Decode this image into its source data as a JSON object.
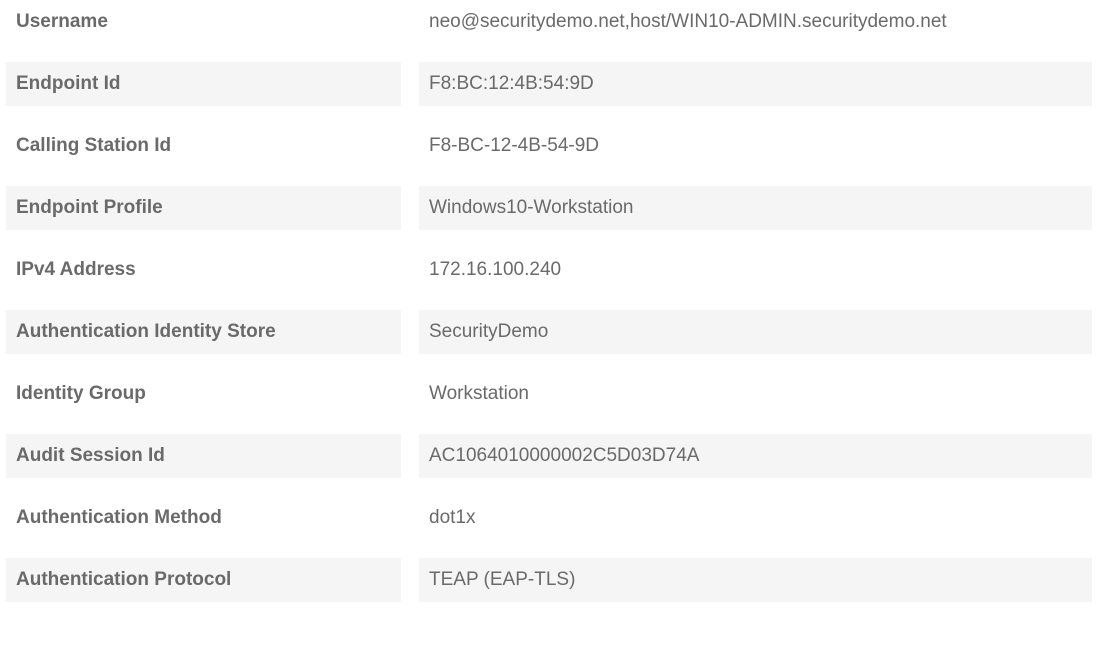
{
  "rows": [
    {
      "label": "Username",
      "value": "neo@securitydemo.net,host/WIN10-ADMIN.securitydemo.net"
    },
    {
      "label": "Endpoint Id",
      "value": "F8:BC:12:4B:54:9D"
    },
    {
      "label": "Calling Station Id",
      "value": "F8-BC-12-4B-54-9D"
    },
    {
      "label": "Endpoint Profile",
      "value": "Windows10-Workstation"
    },
    {
      "label": "IPv4 Address",
      "value": "172.16.100.240"
    },
    {
      "label": "Authentication Identity Store",
      "value": "SecurityDemo"
    },
    {
      "label": "Identity Group",
      "value": "Workstation"
    },
    {
      "label": "Audit Session Id",
      "value": "AC1064010000002C5D03D74A"
    },
    {
      "label": "Authentication Method",
      "value": "dot1x"
    },
    {
      "label": "Authentication Protocol",
      "value": "TEAP (EAP-TLS)"
    }
  ]
}
